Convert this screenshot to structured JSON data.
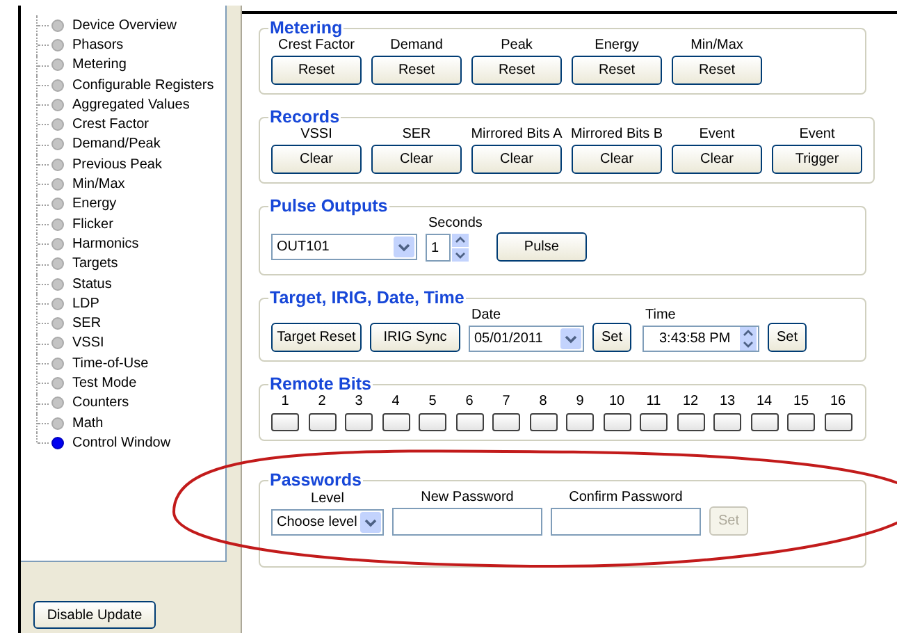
{
  "sidebar": {
    "items": [
      {
        "label": "Device Overview",
        "selected": false
      },
      {
        "label": "Phasors",
        "selected": false
      },
      {
        "label": "Metering",
        "selected": false
      },
      {
        "label": "Configurable Registers",
        "selected": false
      },
      {
        "label": "Aggregated Values",
        "selected": false
      },
      {
        "label": "Crest Factor",
        "selected": false
      },
      {
        "label": "Demand/Peak",
        "selected": false
      },
      {
        "label": "Previous Peak",
        "selected": false
      },
      {
        "label": "Min/Max",
        "selected": false
      },
      {
        "label": "Energy",
        "selected": false
      },
      {
        "label": "Flicker",
        "selected": false
      },
      {
        "label": "Harmonics",
        "selected": false
      },
      {
        "label": "Targets",
        "selected": false
      },
      {
        "label": "Status",
        "selected": false
      },
      {
        "label": "LDP",
        "selected": false
      },
      {
        "label": "SER",
        "selected": false
      },
      {
        "label": "VSSI",
        "selected": false
      },
      {
        "label": "Time-of-Use",
        "selected": false
      },
      {
        "label": "Test Mode",
        "selected": false
      },
      {
        "label": "Counters",
        "selected": false
      },
      {
        "label": "Math",
        "selected": false
      },
      {
        "label": "Control Window",
        "selected": true
      }
    ]
  },
  "disable_update_button": "Disable Update",
  "metering": {
    "title": "Metering",
    "controls": [
      {
        "label": "Crest Factor",
        "button": "Reset"
      },
      {
        "label": "Demand",
        "button": "Reset"
      },
      {
        "label": "Peak",
        "button": "Reset"
      },
      {
        "label": "Energy",
        "button": "Reset"
      },
      {
        "label": "Min/Max",
        "button": "Reset"
      }
    ]
  },
  "records": {
    "title": "Records",
    "controls": [
      {
        "label": "VSSI",
        "button": "Clear"
      },
      {
        "label": "SER",
        "button": "Clear"
      },
      {
        "label": "Mirrored Bits A",
        "button": "Clear"
      },
      {
        "label": "Mirrored Bits B",
        "button": "Clear"
      },
      {
        "label": "Event",
        "button": "Clear"
      },
      {
        "label": "Event",
        "button": "Trigger"
      }
    ]
  },
  "pulse_outputs": {
    "title": "Pulse Outputs",
    "output": "OUT101",
    "seconds_label": "Seconds",
    "seconds": "1",
    "button": "Pulse"
  },
  "target_irig": {
    "title": "Target, IRIG, Date, Time",
    "target_reset_button": "Target Reset",
    "irig_sync_button": "IRIG Sync",
    "date_label": "Date",
    "date": "05/01/2011",
    "date_set_button": "Set",
    "time_label": "Time",
    "time": "3:43:58 PM",
    "time_set_button": "Set"
  },
  "remote_bits": {
    "title": "Remote Bits",
    "bits": [
      "1",
      "2",
      "3",
      "4",
      "5",
      "6",
      "7",
      "8",
      "9",
      "10",
      "11",
      "12",
      "13",
      "14",
      "15",
      "16"
    ]
  },
  "passwords": {
    "title": "Passwords",
    "level_label": "Level",
    "level": "Choose level",
    "new_password_label": "New Password",
    "confirm_password_label": "Confirm Password",
    "set_button": {
      "label": "Set",
      "disabled": true
    }
  }
}
